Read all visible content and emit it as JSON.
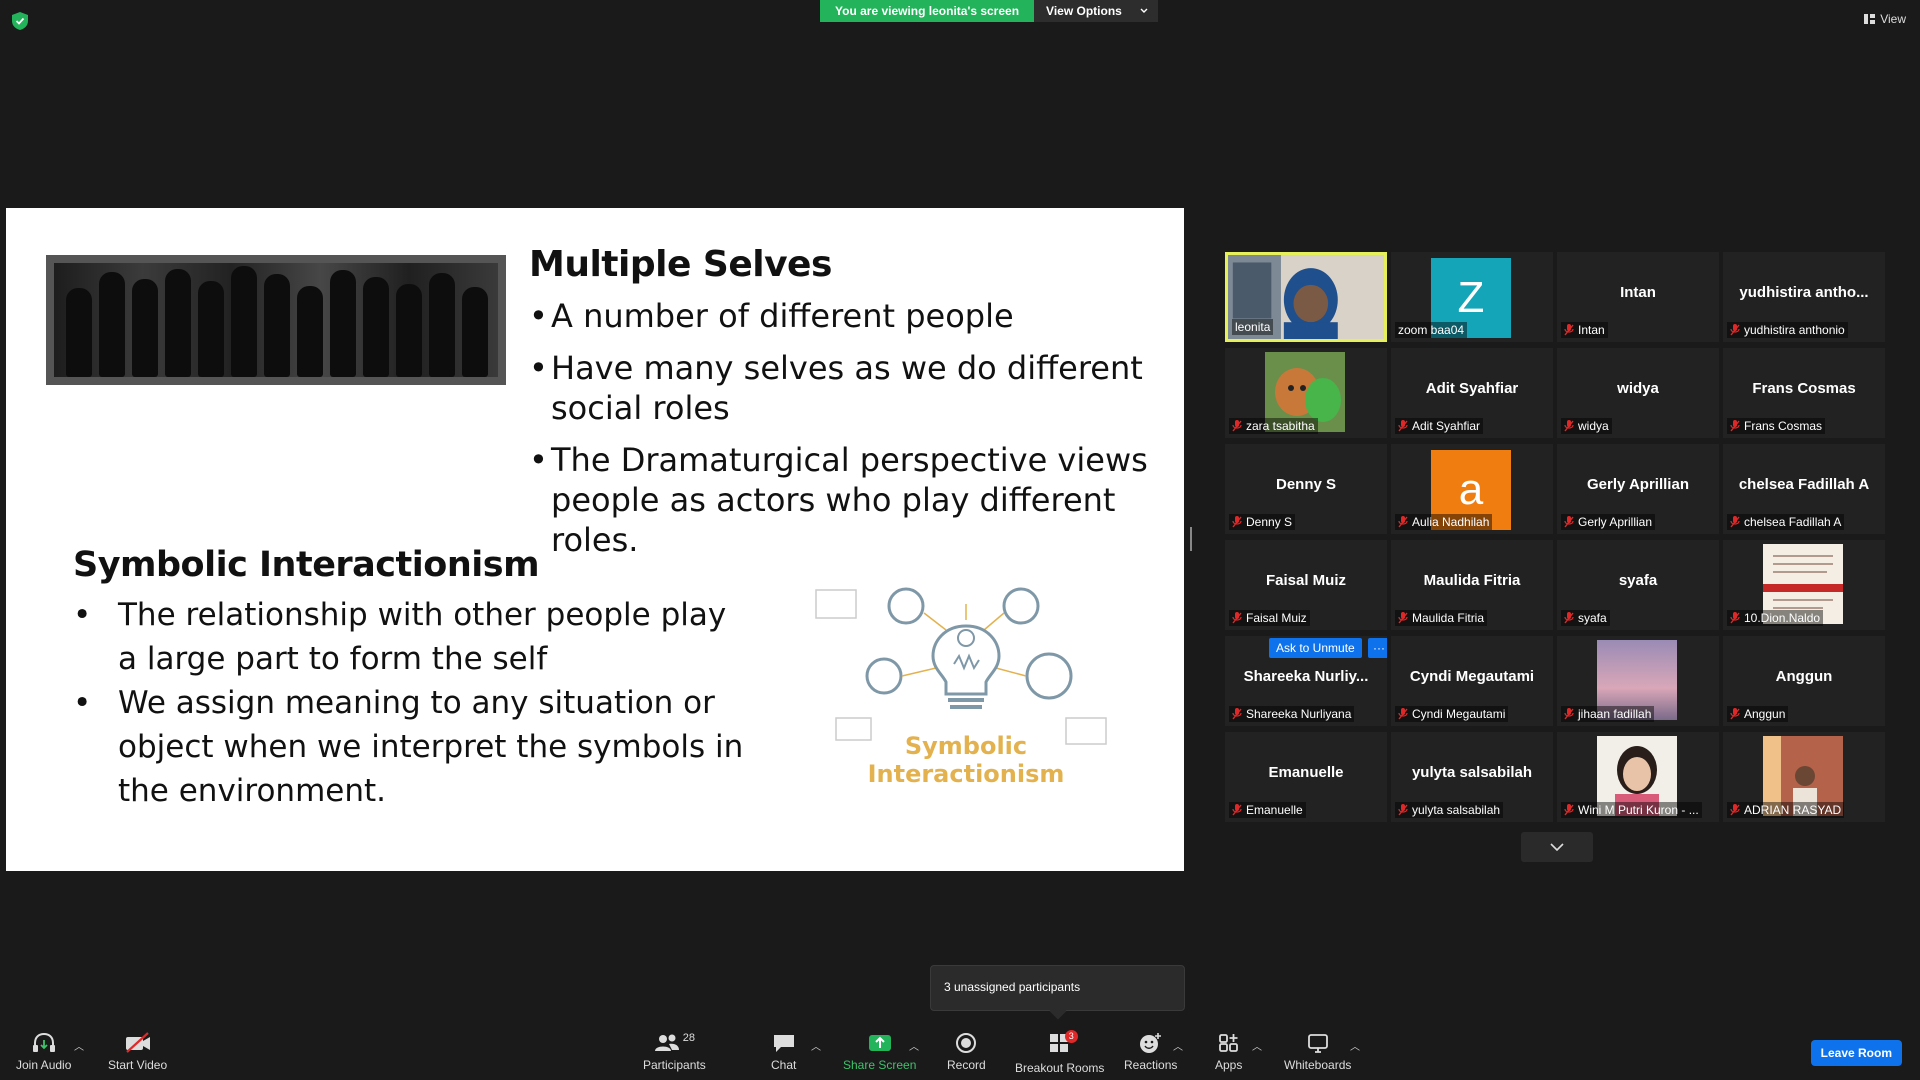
{
  "banner": {
    "viewing_text": "You are viewing leonita's screen",
    "view_options_label": "View Options"
  },
  "top_view_label": "View",
  "slide": {
    "title1": "Multiple Selves",
    "bullets1": [
      "A number of different people",
      "Have many selves as we do different social roles",
      "The Dramaturgical perspective views people as actors who play different roles."
    ],
    "title2": "Symbolic Interactionism",
    "bullets2": [
      "The relationship with other people play a large part to form the self",
      "We assign meaning to any situation or object when we interpret the symbols in the environment."
    ],
    "diagram_text_line1": "Symbolic",
    "diagram_text_line2": "Interactionism",
    "diagram_color": "#e3b24f"
  },
  "gallery": {
    "tiles": [
      {
        "center": "",
        "label": "leonita",
        "kind": "video-leonita"
      },
      {
        "center": "",
        "label": "zoom baa04",
        "kind": "letter",
        "letter": "Z",
        "color": "#14a5b8"
      },
      {
        "center": "Intan",
        "label": "Intan"
      },
      {
        "center": "yudhistira antho...",
        "label": "yudhistira anthonio"
      },
      {
        "center": "",
        "label": "zara tsabitha",
        "kind": "pic-cat"
      },
      {
        "center": "Adit Syahfiar",
        "label": "Adit Syahfiar"
      },
      {
        "center": "widya",
        "label": "widya"
      },
      {
        "center": "Frans Cosmas",
        "label": "Frans Cosmas"
      },
      {
        "center": "Denny S",
        "label": "Denny S"
      },
      {
        "center": "",
        "label": "Aulia Nadhilah",
        "kind": "letter",
        "letter": "a",
        "color": "#f07d0f"
      },
      {
        "center": "Gerly Aprillian",
        "label": "Gerly Aprillian"
      },
      {
        "center": "chelsea Fadillah A",
        "label": "chelsea Fadillah A"
      },
      {
        "center": "Faisal Muiz",
        "label": "Faisal Muiz"
      },
      {
        "center": "Maulida Fitria",
        "label": "Maulida Fitria"
      },
      {
        "center": "syafa",
        "label": "syafa"
      },
      {
        "center": "",
        "label": "10.Dion.Naldo",
        "kind": "pic-doc"
      },
      {
        "center": "Shareeka Nurliy...",
        "label": "Shareeka Nurliyana",
        "kind": "hover"
      },
      {
        "center": "Cyndi Megautami",
        "label": "Cyndi Megautami"
      },
      {
        "center": "",
        "label": "jihaan fadillah",
        "kind": "pic-sky"
      },
      {
        "center": "Anggun",
        "label": "Anggun"
      },
      {
        "center": "Emanuelle",
        "label": "Emanuelle"
      },
      {
        "center": "yulyta salsabilah",
        "label": "yulyta salsabilah"
      },
      {
        "center": "",
        "label": "Wini M Putri Kuron - ...",
        "kind": "pic-girl"
      },
      {
        "center": "",
        "label": "ADRIAN RASYAD",
        "kind": "pic-man"
      }
    ],
    "ask_to_unmute": "Ask to Unmute",
    "more": "···"
  },
  "tooltip": "3 unassigned participants",
  "toolbar": {
    "join_audio": "Join Audio",
    "start_video": "Start Video",
    "participants": "Participants",
    "participant_count": "28",
    "chat": "Chat",
    "share_screen": "Share Screen",
    "record": "Record",
    "breakout_rooms": "Breakout Rooms",
    "breakout_badge": "3",
    "reactions": "Reactions",
    "apps": "Apps",
    "whiteboards": "Whiteboards",
    "leave_room": "Leave Room"
  }
}
